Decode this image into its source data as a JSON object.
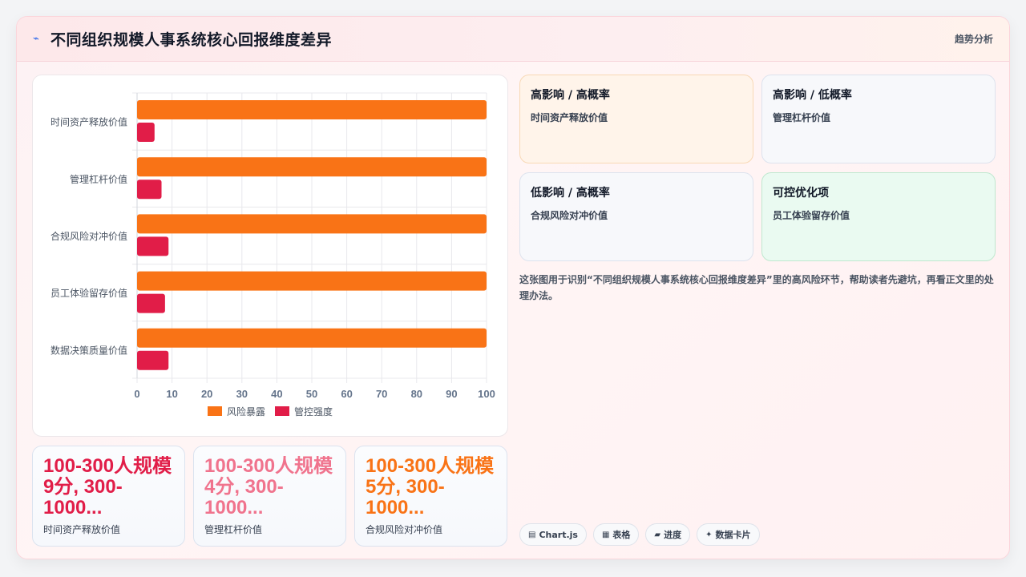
{
  "header": {
    "title": "不同组织规模人事系统核心回报维度差异",
    "icon": "chart-line-icon",
    "action_label": "趋势分析"
  },
  "chart_data": {
    "type": "bar",
    "orientation": "horizontal",
    "categories": [
      "时间资产释放价值",
      "管理杠杆价值",
      "合规风险对冲价值",
      "员工体验留存价值",
      "数据决策质量价值"
    ],
    "series": [
      {
        "name": "风险暴露",
        "color": "#f97316",
        "values": [
          100,
          100,
          100,
          100,
          100
        ]
      },
      {
        "name": "管控强度",
        "color": "#e11d48",
        "values": [
          5,
          7,
          9,
          8,
          9
        ]
      }
    ],
    "xlim": [
      0,
      100
    ],
    "xticks": [
      "0",
      "10",
      "20",
      "30",
      "40",
      "50",
      "60",
      "70",
      "80",
      "90",
      "100"
    ],
    "grid": true,
    "legend": "bottom"
  },
  "stats": [
    {
      "value": "100-300人规模9分, 300-1000...",
      "label": "时间资产释放价值",
      "color": "#e11d48"
    },
    {
      "value": "100-300人规模4分, 300-1000...",
      "label": "管理杠杆价值",
      "color": "#f0738d"
    },
    {
      "value": "100-300人规模5分, 300-1000...",
      "label": "合规风险对冲价值",
      "color": "#f97316"
    }
  ],
  "quadrants": [
    {
      "title": "高影响 / 高概率",
      "item": "时间资产释放价值",
      "bg": "#fff4ea",
      "border": "#f8d9b5"
    },
    {
      "title": "高影响 / 低概率",
      "item": "管理杠杆价值",
      "bg": "#f7f8fb",
      "border": "#dde3ee"
    },
    {
      "title": "低影响 / 高概率",
      "item": "合规风险对冲价值",
      "bg": "#f7f8fb",
      "border": "#dde3ee"
    },
    {
      "title": "可控优化项",
      "item": "员工体验留存价值",
      "bg": "#eafaf1",
      "border": "#bfe8cf"
    }
  ],
  "description": "这张图用于识别“不同组织规模人事系统核心回报维度差异”里的高风险环节，帮助读者先避坑，再看正文里的处理办法。",
  "tags": [
    {
      "icon": "▤",
      "label": "Chart.js"
    },
    {
      "icon": "▦",
      "label": "表格"
    },
    {
      "icon": "▰",
      "label": "进度"
    },
    {
      "icon": "✦",
      "label": "数据卡片"
    }
  ]
}
